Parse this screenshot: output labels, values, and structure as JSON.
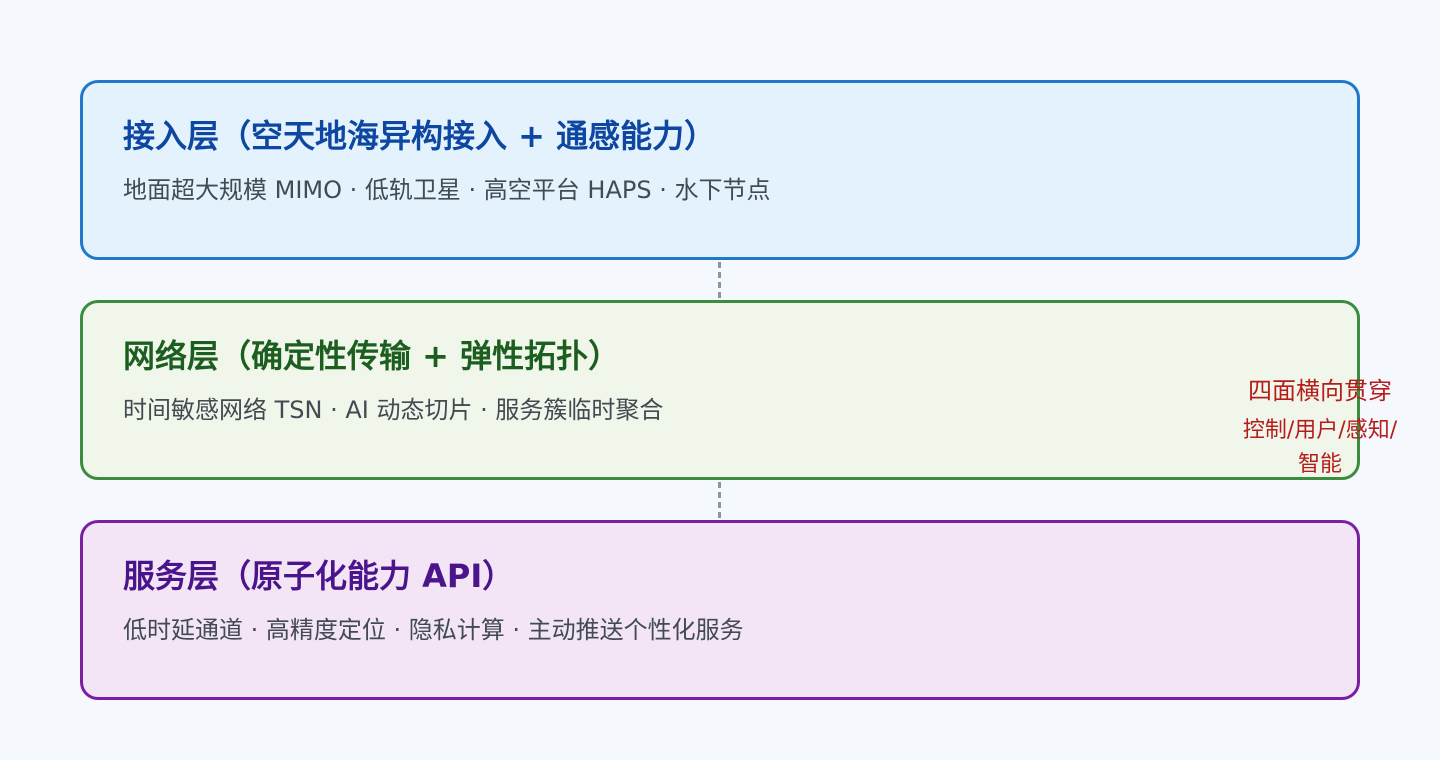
{
  "layers": [
    {
      "title": "接入层（空天地海异构接入 + 通感能力）",
      "desc": "地面超大规模 MIMO · 低轨卫星 · 高空平台 HAPS · 水下节点"
    },
    {
      "title": "网络层（确定性传输 + 弹性拓扑）",
      "desc": "时间敏感网络 TSN · AI 动态切片 · 服务簇临时聚合"
    },
    {
      "title": "服务层（原子化能力 API）",
      "desc": "低时延通道 · 高精度定位 · 隐私计算 · 主动推送个性化服务"
    }
  ],
  "cross_cutting": {
    "title": "四面横向贯穿",
    "subtitle": "控制/用户/感知/智能"
  },
  "colors": {
    "access_border": "#1f78c8",
    "network_border": "#3b8c3f",
    "service_border": "#7b1fa2",
    "note": "#b71c1c"
  }
}
